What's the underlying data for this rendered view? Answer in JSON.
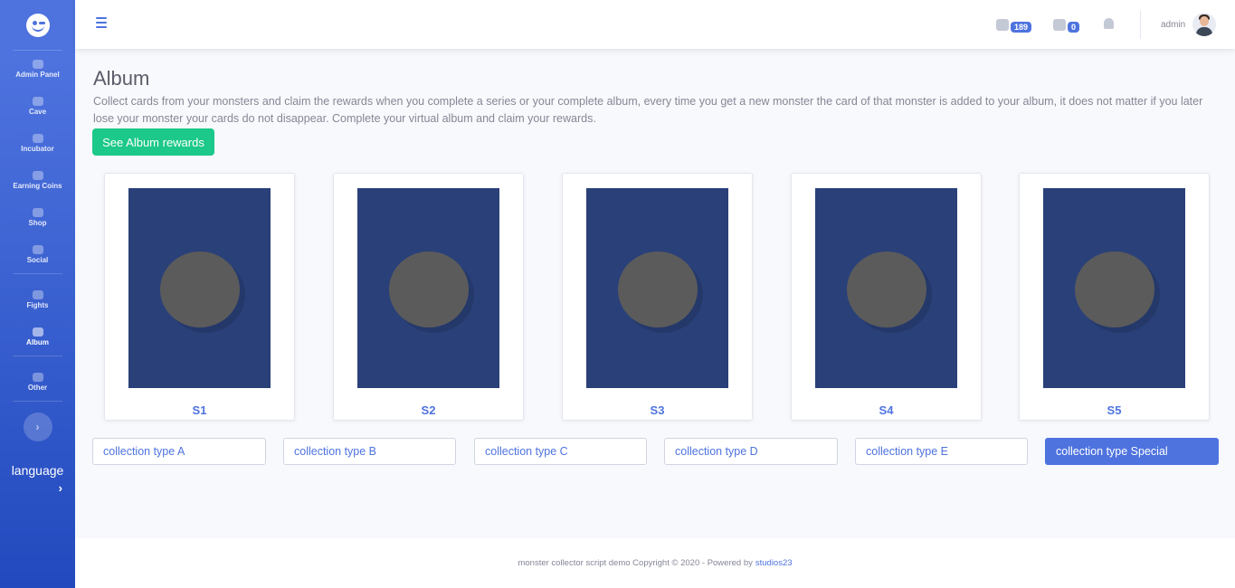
{
  "sidebar": {
    "logo": "smiley-logo",
    "items": [
      {
        "label": "Admin Panel",
        "icon": "users-cog-icon"
      },
      {
        "label": "Cave",
        "icon": "cave-icon"
      },
      {
        "label": "Incubator",
        "icon": "egg-icon"
      },
      {
        "label": "Earning Coins",
        "icon": "coins-icon"
      },
      {
        "label": "Shop",
        "icon": "cart-icon"
      },
      {
        "label": "Social",
        "icon": "chat-icon"
      },
      {
        "label": "Fights",
        "icon": "trophy-icon"
      },
      {
        "label": "Album",
        "icon": "album-icon"
      },
      {
        "label": "Other",
        "icon": "info-icon"
      }
    ],
    "toggle_glyph": "›",
    "language_label": "language",
    "language_chevron": "›"
  },
  "topbar": {
    "coins_count": "189",
    "gems_count": "0",
    "user_name": "admin"
  },
  "main": {
    "title": "Album",
    "description": "Collect cards from your monsters and claim the rewards when you complete a series or your complete album, every time you get a new monster the card of that monster is added to your album, it does not matter if you later lose your monster your cards do not disappear. Complete your virtual album and claim your rewards.",
    "rewards_button": "See Album rewards",
    "cards": [
      {
        "label": "S1"
      },
      {
        "label": "S2"
      },
      {
        "label": "S3"
      },
      {
        "label": "S4"
      },
      {
        "label": "S5"
      }
    ],
    "collections": [
      {
        "label": "collection type A",
        "active": false
      },
      {
        "label": "collection type B",
        "active": false
      },
      {
        "label": "collection type C",
        "active": false
      },
      {
        "label": "collection type D",
        "active": false
      },
      {
        "label": "collection type E",
        "active": false
      },
      {
        "label": "collection type Special",
        "active": true
      }
    ]
  },
  "footer": {
    "text": "monster collector script demo Copyright © 2020 - Powered by",
    "link": "studios23"
  },
  "colors": {
    "primary": "#4e73df",
    "success": "#1cc88a",
    "card_bg": "#2a4079"
  }
}
